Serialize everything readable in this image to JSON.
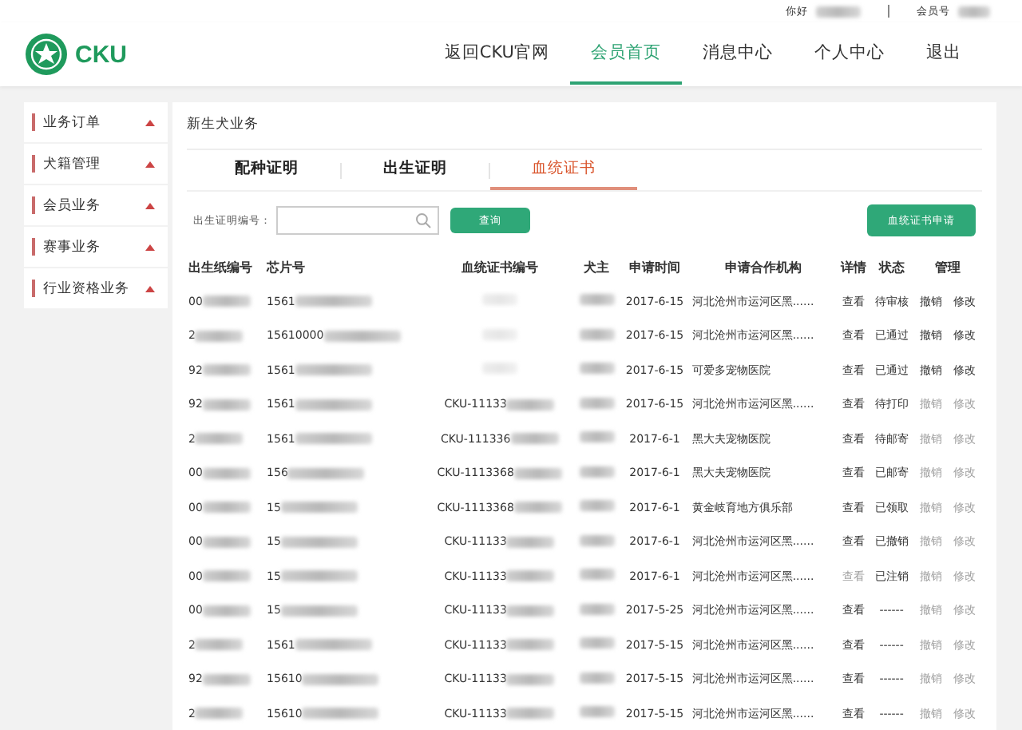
{
  "topbar": {
    "greeting": "你好",
    "member_label": "会员号"
  },
  "logo": {
    "text": "CKU"
  },
  "nav": [
    {
      "label": "返回CKU官网",
      "selected": false
    },
    {
      "label": "会员首页",
      "selected": true
    },
    {
      "label": "消息中心",
      "selected": false
    },
    {
      "label": "个人中心",
      "selected": false
    },
    {
      "label": "退出",
      "selected": false
    }
  ],
  "sidebar": {
    "items": [
      {
        "label": "业务订单",
        "expanded": false
      },
      {
        "label": "犬籍管理",
        "expanded": false
      },
      {
        "label": "会员业务",
        "expanded": false
      },
      {
        "label": "赛事业务",
        "expanded": false
      },
      {
        "label": "行业资格业务",
        "expanded": false
      }
    ]
  },
  "panel": {
    "title": "新生犬业务",
    "tabs": [
      {
        "label": "配种证明",
        "selected": false
      },
      {
        "label": "出生证明",
        "selected": false
      },
      {
        "label": "血统证书",
        "selected": true
      }
    ],
    "search": {
      "label": "出生证明编号："
    },
    "query_button": "查询",
    "apply_button": "血统证书申请",
    "table": {
      "columns": [
        "出生纸编号",
        "芯片号",
        "血统证书编号",
        "犬主",
        "申请时间",
        "申请合作机构",
        "详情",
        "状态",
        "管理"
      ],
      "rows": [
        {
          "birth_no": "00",
          "chip": "1561",
          "cert": "",
          "date": "2017-6-15",
          "org": "河北沧州市运河区黑......",
          "detail": "查看",
          "detail_enabled": true,
          "status": "待审核",
          "actions": [
            "撤销",
            "修改"
          ],
          "actions_enabled": true
        },
        {
          "birth_no": "2",
          "chip": "15610000",
          "cert": "",
          "date": "2017-6-15",
          "org": "河北沧州市运河区黑......",
          "detail": "查看",
          "detail_enabled": true,
          "status": "已通过",
          "actions": [
            "撤销",
            "修改"
          ],
          "actions_enabled": true
        },
        {
          "birth_no": "92",
          "chip": "1561",
          "cert": "",
          "date": "2017-6-15",
          "org": "可爱多宠物医院",
          "detail": "查看",
          "detail_enabled": true,
          "status": "已通过",
          "actions": [
            "撤销",
            "修改"
          ],
          "actions_enabled": true
        },
        {
          "birth_no": "92",
          "chip": "1561",
          "cert": "CKU-11133",
          "date": "2017-6-15",
          "org": "河北沧州市运河区黑......",
          "detail": "查看",
          "detail_enabled": true,
          "status": "待打印",
          "actions": [
            "撤销",
            "修改"
          ],
          "actions_enabled": false
        },
        {
          "birth_no": "2",
          "chip": "1561",
          "cert": "CKU-111336",
          "date": "2017-6-1",
          "org": "黑大夫宠物医院",
          "detail": "查看",
          "detail_enabled": true,
          "status": "待邮寄",
          "actions": [
            "撤销",
            "修改"
          ],
          "actions_enabled": false
        },
        {
          "birth_no": "00",
          "chip": "156",
          "cert": "CKU-1113368",
          "date": "2017-6-1",
          "org": "黑大夫宠物医院",
          "detail": "查看",
          "detail_enabled": true,
          "status": "已邮寄",
          "actions": [
            "撤销",
            "修改"
          ],
          "actions_enabled": false
        },
        {
          "birth_no": "00",
          "chip": "15",
          "cert": "CKU-1113368",
          "date": "2017-6-1",
          "org": "黄金岐育地方俱乐部",
          "detail": "查看",
          "detail_enabled": true,
          "status": "已领取",
          "actions": [
            "撤销",
            "修改"
          ],
          "actions_enabled": false
        },
        {
          "birth_no": "00",
          "chip": "15",
          "cert": "CKU-11133",
          "date": "2017-6-1",
          "org": "河北沧州市运河区黑......",
          "detail": "查看",
          "detail_enabled": true,
          "status": "已撤销",
          "actions": [
            "撤销",
            "修改"
          ],
          "actions_enabled": false
        },
        {
          "birth_no": "00",
          "chip": "15",
          "cert": "CKU-11133",
          "date": "2017-6-1",
          "org": "河北沧州市运河区黑......",
          "detail": "查看",
          "detail_enabled": false,
          "status": "已注销",
          "actions": [
            "撤销",
            "修改"
          ],
          "actions_enabled": false
        },
        {
          "birth_no": "00",
          "chip": "15",
          "cert": "CKU-11133",
          "date": "2017-5-25",
          "org": "河北沧州市运河区黑......",
          "detail": "查看",
          "detail_enabled": true,
          "status": "------",
          "actions": [
            "撤销",
            "修改"
          ],
          "actions_enabled": false
        },
        {
          "birth_no": "2",
          "chip": "1561",
          "cert": "CKU-11133",
          "date": "2017-5-15",
          "org": "河北沧州市运河区黑......",
          "detail": "查看",
          "detail_enabled": true,
          "status": "------",
          "actions": [
            "撤销",
            "修改"
          ],
          "actions_enabled": false
        },
        {
          "birth_no": "92",
          "chip": "15610",
          "cert": "CKU-11133",
          "date": "2017-5-15",
          "org": "河北沧州市运河区黑......",
          "detail": "查看",
          "detail_enabled": true,
          "status": "------",
          "actions": [
            "撤销",
            "修改"
          ],
          "actions_enabled": false
        },
        {
          "birth_no": "2",
          "chip": "15610",
          "cert": "CKU-11133",
          "date": "2017-5-15",
          "org": "河北沧州市运河区黑......",
          "detail": "查看",
          "detail_enabled": true,
          "status": "------",
          "actions": [
            "撤销",
            "修改"
          ],
          "actions_enabled": false
        }
      ]
    }
  }
}
